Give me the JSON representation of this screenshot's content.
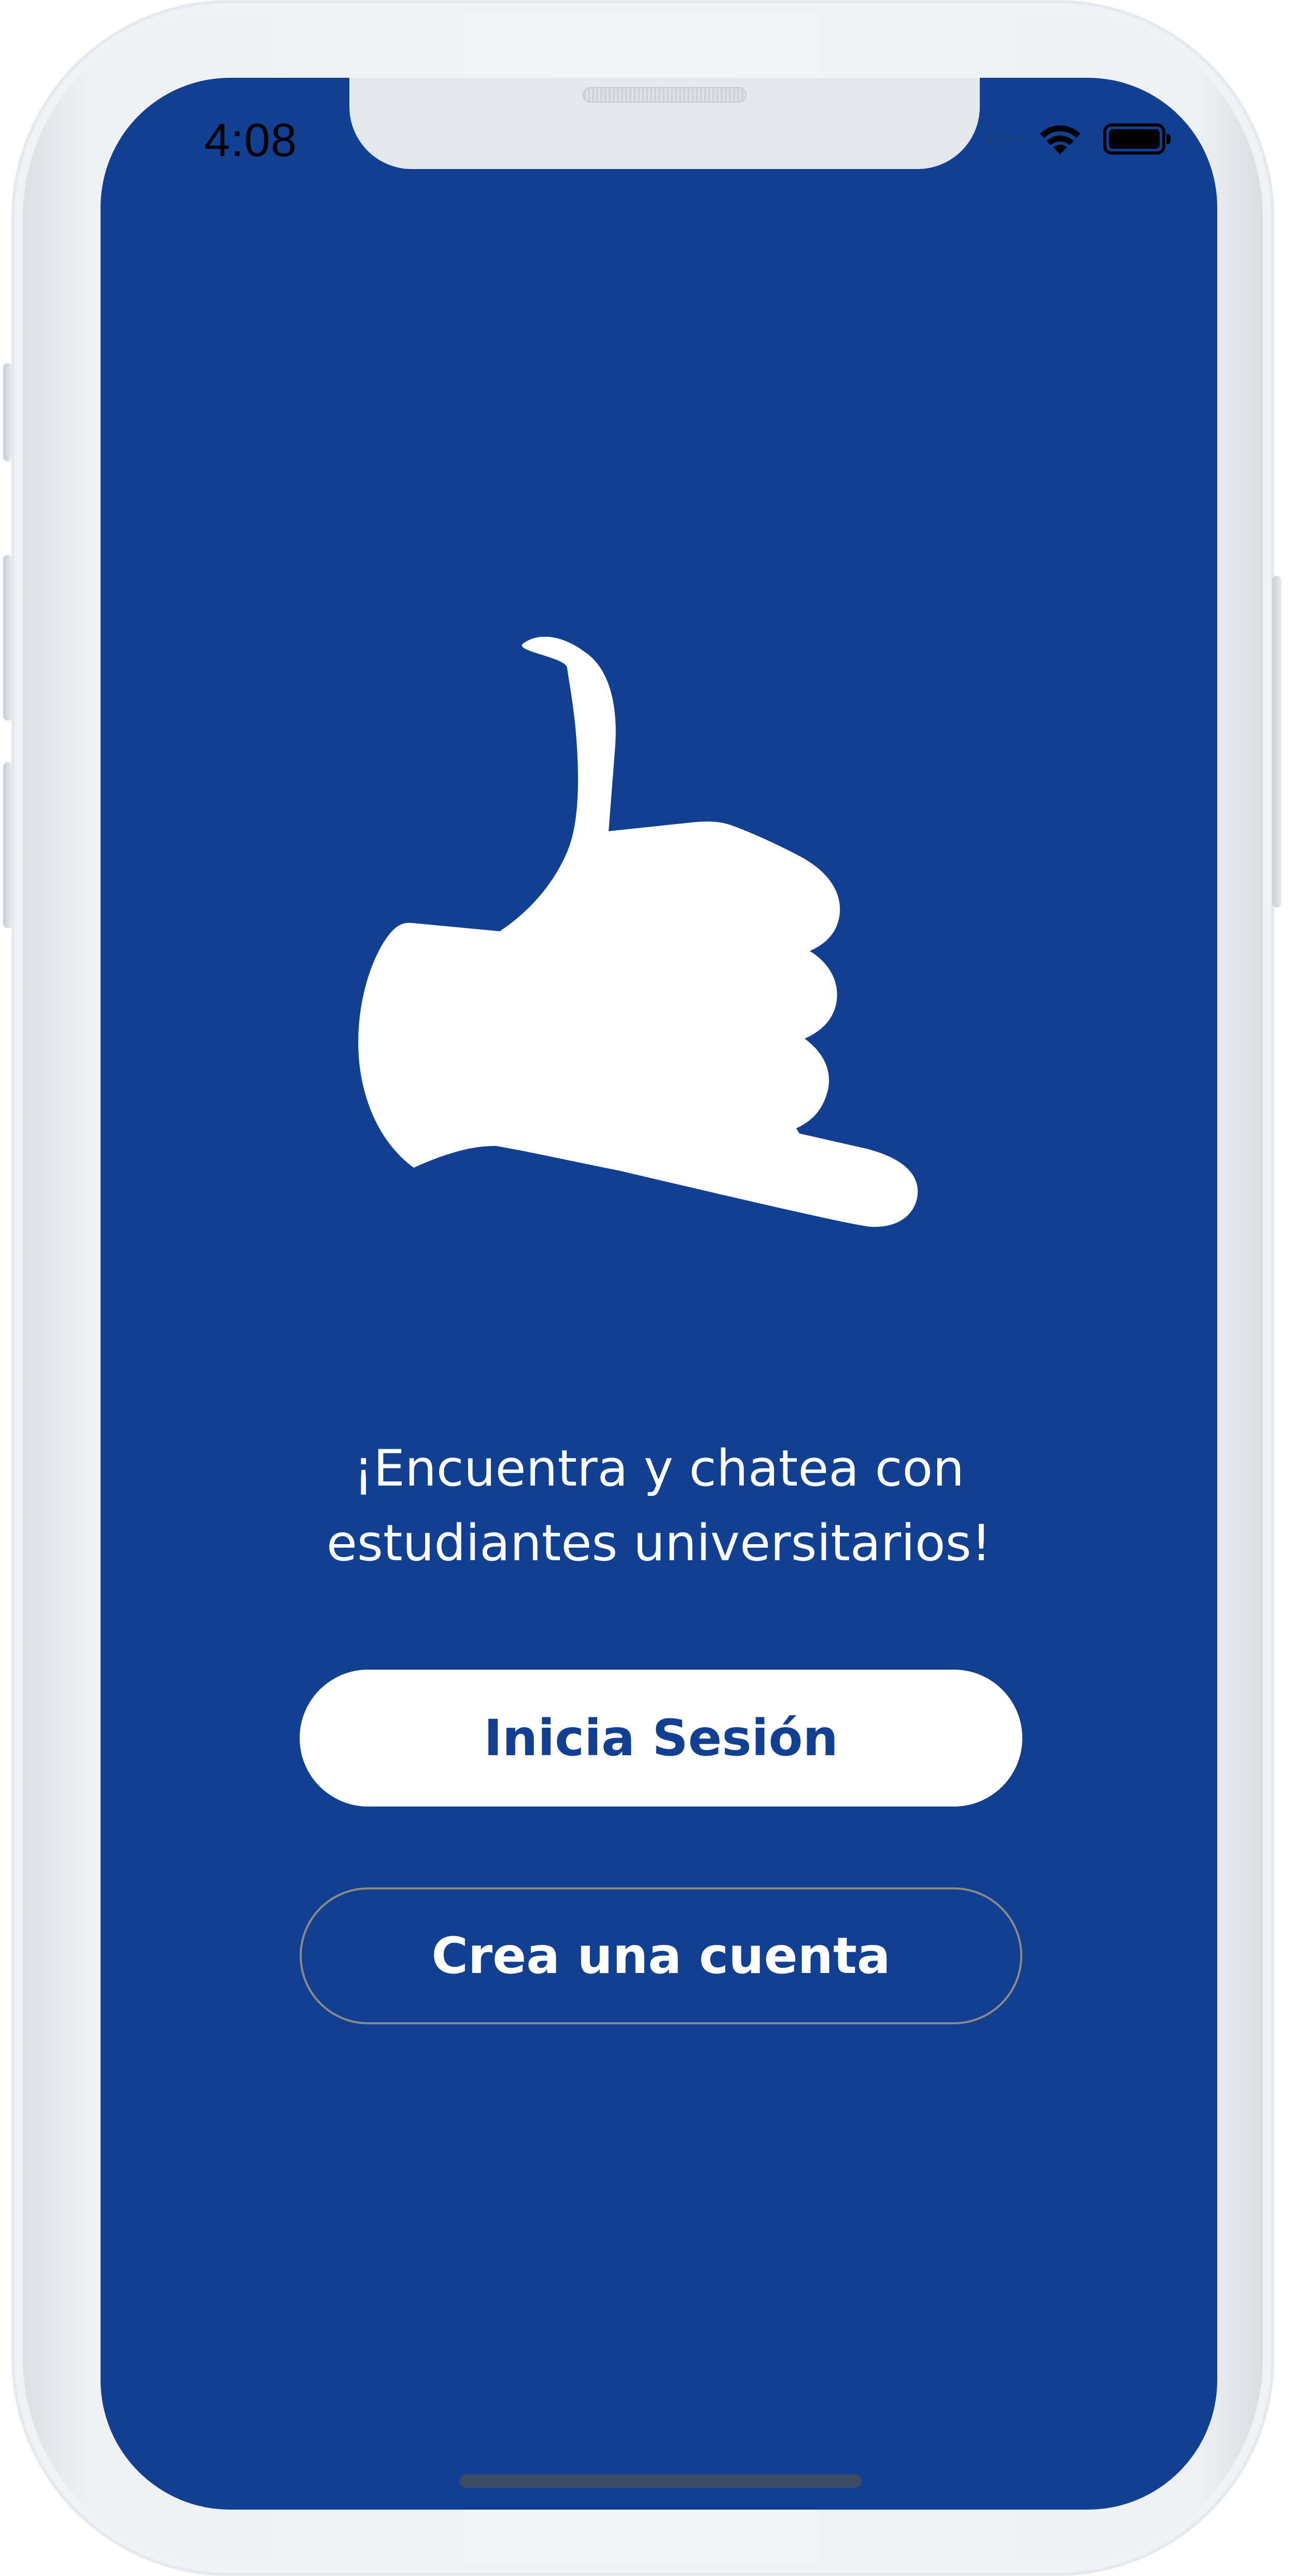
{
  "status_bar": {
    "time": "4:08"
  },
  "welcome": {
    "tagline_line1": "¡Encuentra y chatea con",
    "tagline_line2": "estudiantes universitarios!"
  },
  "buttons": {
    "login_label": "Inicia Sesión",
    "signup_label": "Crea una cuenta"
  },
  "icons": {
    "logo": "shaka-hand-icon",
    "wifi": "wifi-icon",
    "battery": "battery-icon",
    "signal": "signal-dots-icon"
  },
  "colors": {
    "background": "#113f91",
    "primary_text_on_white": "#113f91",
    "white": "#ffffff",
    "outline_border": "#8d8a86"
  }
}
